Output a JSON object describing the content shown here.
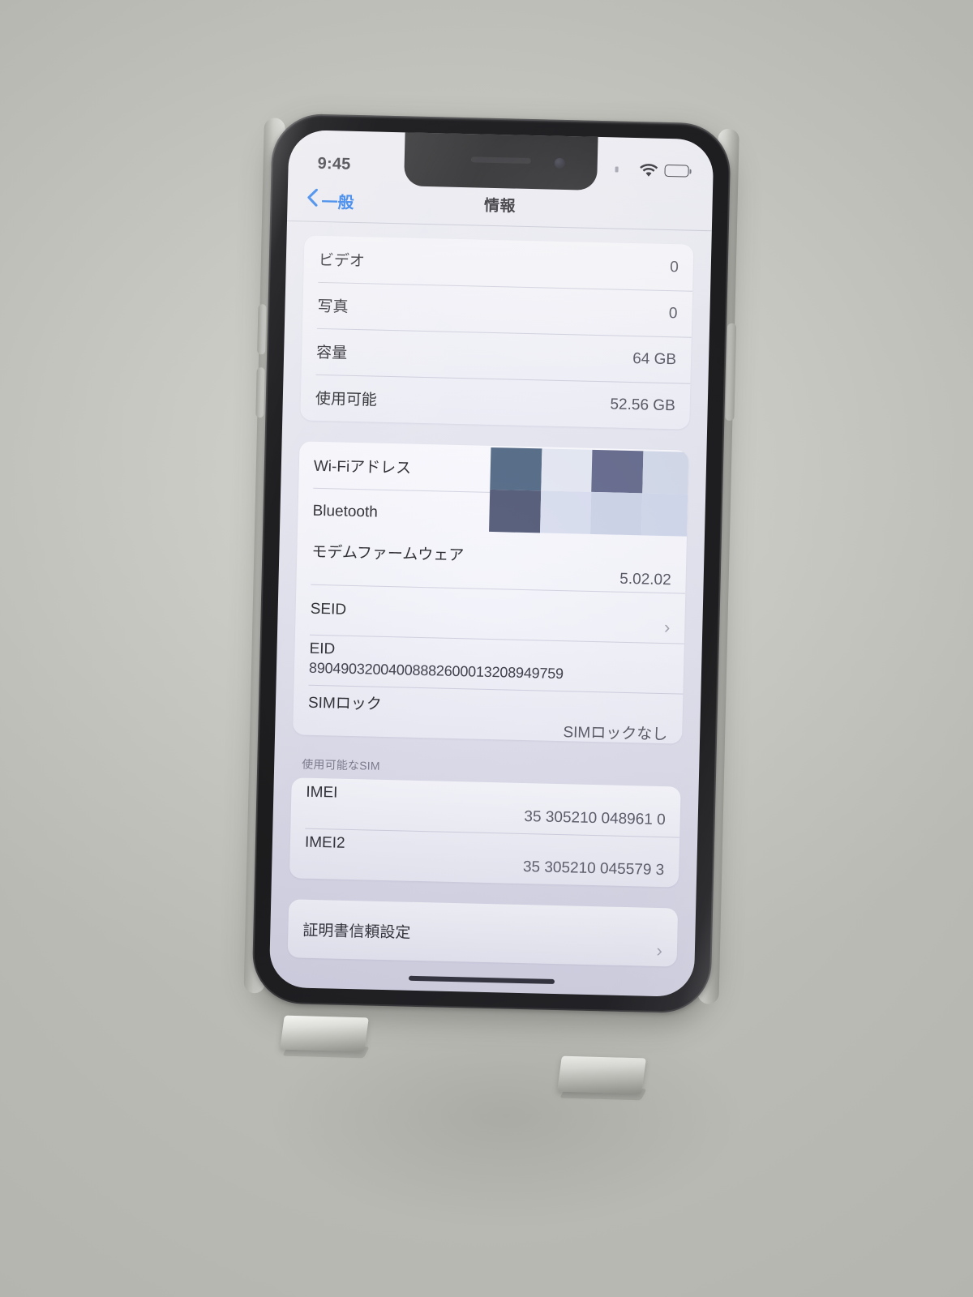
{
  "scene": {
    "description": "photo-of-iphone-on-stand",
    "background_color": "#c8c8c2"
  },
  "device": {
    "frame_color": "#0a0a0d",
    "side_color": "#dcdcd7"
  },
  "status_bar": {
    "time": "9:45",
    "wifi_icon": "wifi-icon",
    "battery_icon": "battery-full-icon",
    "dot_icon": "location-dot-icon"
  },
  "nav": {
    "back_label": "一般",
    "back_icon": "chevron-left-icon",
    "title": "情報"
  },
  "accent_color": "#0a6cf0",
  "groups": [
    {
      "header": "",
      "rows": [
        {
          "label": "ビデオ",
          "value": "0",
          "style": "plain"
        },
        {
          "label": "写真",
          "value": "0",
          "style": "plain"
        },
        {
          "label": "容量",
          "value": "64 GB",
          "style": "plain"
        },
        {
          "label": "使用可能",
          "value": "52.56 GB",
          "style": "plain"
        }
      ]
    },
    {
      "header": "",
      "rows": [
        {
          "label": "Wi-Fiアドレス",
          "value": "",
          "style": "redacted"
        },
        {
          "label": "Bluetooth",
          "value": "",
          "style": "redacted"
        },
        {
          "label": "モデムファームウェア",
          "value": "5.02.02",
          "style": "stack"
        },
        {
          "label": "SEID",
          "value": "",
          "style": "chevron",
          "chevron": "›"
        },
        {
          "label": "EID",
          "value": "89049032004008882600013208949759",
          "style": "stack-wide"
        },
        {
          "label": "SIMロック",
          "value": "SIMロックなし",
          "style": "stack"
        }
      ]
    },
    {
      "header": "使用可能なSIM",
      "rows": [
        {
          "label": "IMEI",
          "value": "35 305210 048961 0",
          "style": "stack"
        },
        {
          "label": "IMEI2",
          "value": "35 305210 045579 3",
          "style": "stack"
        }
      ]
    },
    {
      "header": "",
      "rows": [
        {
          "label": "証明書信頼設定",
          "value": "",
          "style": "chevron",
          "chevron": "›"
        }
      ]
    }
  ],
  "redaction": {
    "type": "mosaic",
    "colors": [
      "#48607e",
      "#dde2f0",
      "#5b6186",
      "#cfd6e8",
      "#48506f",
      "#d6dbee",
      "#c9d0e6",
      "#cdd4e9"
    ]
  },
  "home_indicator": "home-indicator"
}
